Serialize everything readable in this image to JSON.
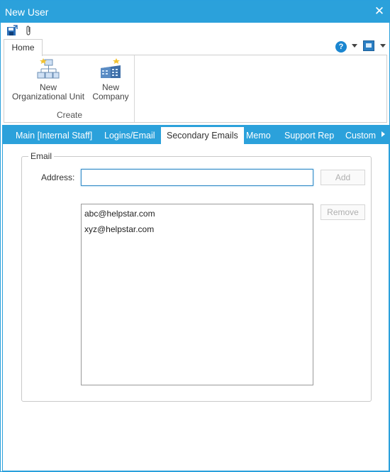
{
  "window": {
    "title": "New User",
    "close_glyph": "✕"
  },
  "quick_access": [
    {
      "icon": "save-close-icon"
    },
    {
      "icon": "attachment-icon"
    }
  ],
  "ribbon": {
    "tab": "Home",
    "group": {
      "label": "Create",
      "buttons": [
        {
          "line1": "New",
          "line2": "Organizational Unit",
          "icon": "org-chart-icon"
        },
        {
          "line1": "New",
          "line2": "Company",
          "icon": "building-icon"
        }
      ]
    },
    "help_glyph": "?"
  },
  "tabs": [
    {
      "label": "Main [Internal Staff]",
      "active": false
    },
    {
      "label": "Logins/Email",
      "active": false
    },
    {
      "label": "Secondary Emails",
      "active": true
    },
    {
      "label": "Memo",
      "active": false
    },
    {
      "label": "Support Rep",
      "active": false
    },
    {
      "label": "Custom",
      "active": false
    }
  ],
  "email_section": {
    "legend": "Email",
    "address_label": "Address:",
    "address_value": "",
    "add_label": "Add",
    "remove_label": "Remove",
    "emails": [
      "abc@helpstar.com",
      "xyz@helpstar.com"
    ]
  },
  "colors": {
    "accent": "#2ba1db",
    "disabled_text": "#b0b0b0"
  }
}
